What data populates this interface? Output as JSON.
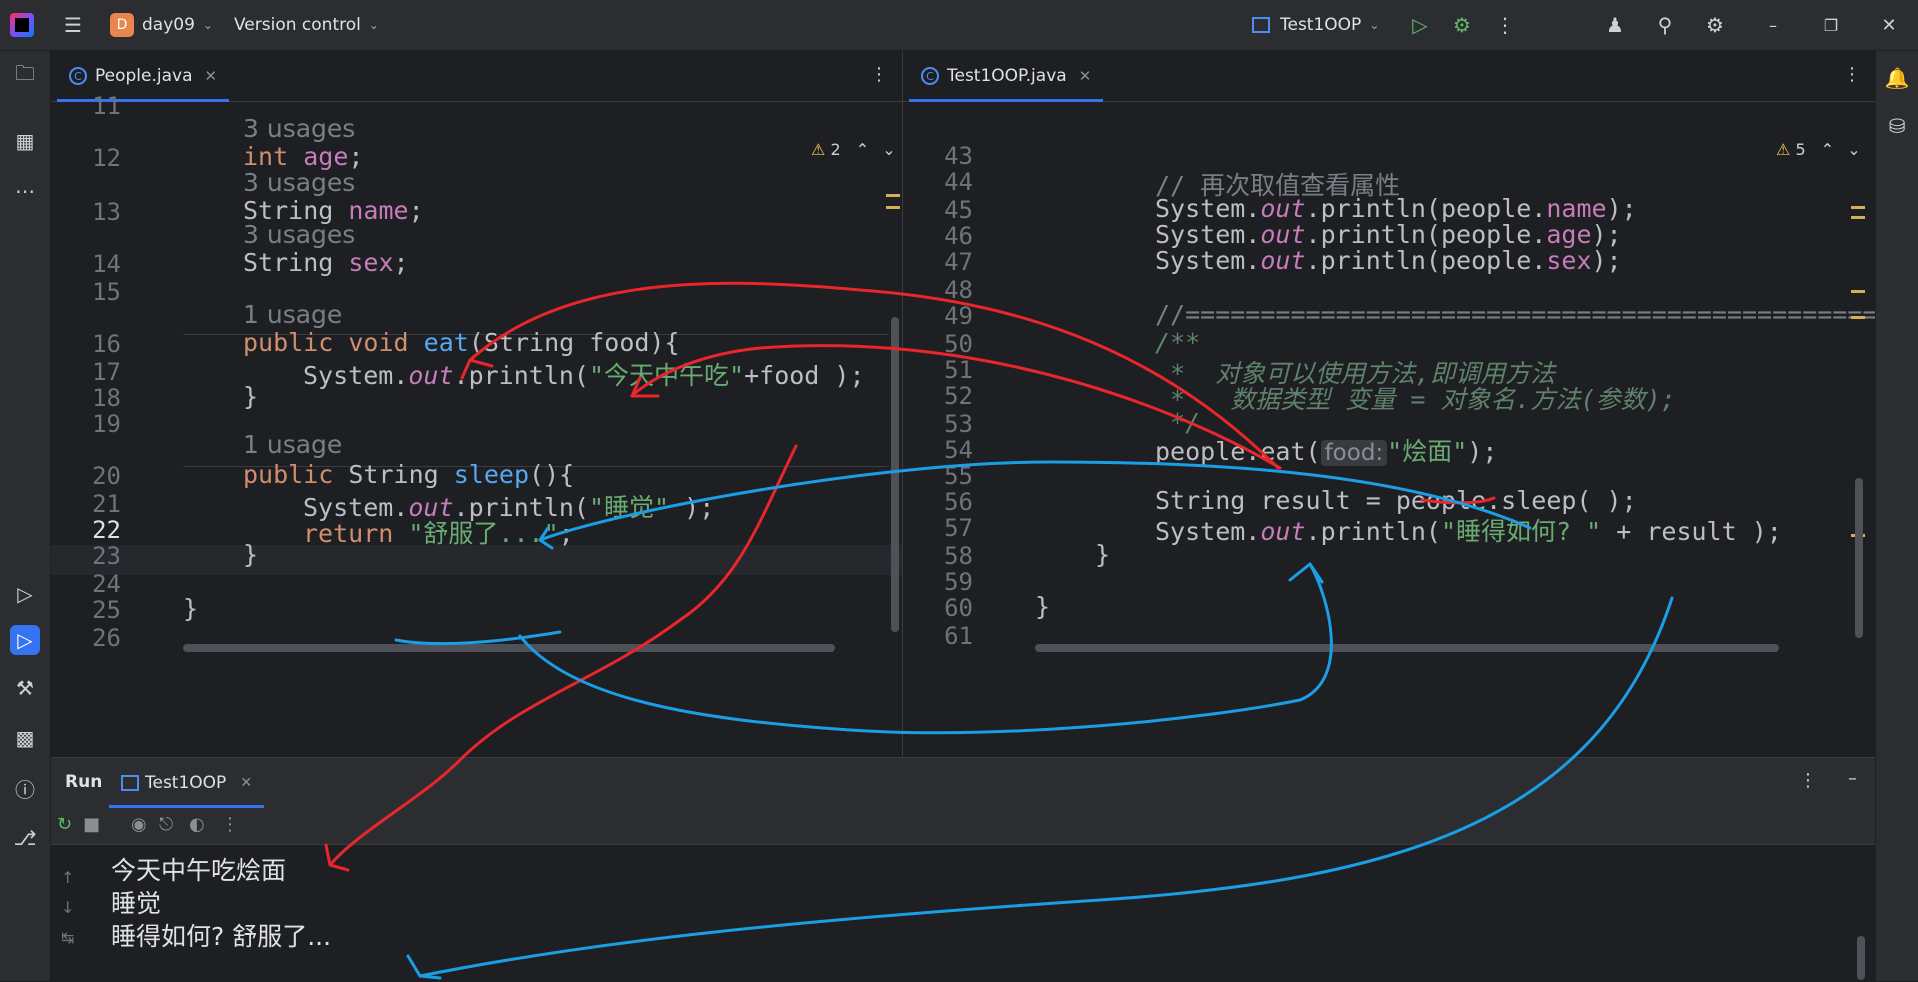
{
  "titlebar": {
    "project_badge": "D",
    "project_name": "day09",
    "vcs": "Version control",
    "run_config": "Test1OOP"
  },
  "left_editor": {
    "tab": "People.java",
    "warnings": "2",
    "lines": {
      "n11": "11",
      "u12": "3 usages",
      "n12": "12",
      "n13": "13",
      "u13": "3 usages",
      "n14": "14",
      "u14": "3 usages",
      "n15": "15",
      "u16": "1 usage",
      "n16": "16",
      "n17": "17",
      "n18": "18",
      "n19": "19",
      "u20": "1 usage",
      "n20": "20",
      "n21": "21",
      "n22": "22",
      "n23": "23",
      "n24": "24",
      "n25": "25",
      "n26": "26"
    },
    "code": {
      "int": "int",
      "age": "age",
      "semi": ";",
      "String": "String",
      "name": "name",
      "sex": "sex",
      "public": "public",
      "void": "void",
      "eat": "eat",
      "eat_params": "(String food){",
      "sys": "System.",
      "out": "out",
      "println": ".println(",
      "str_lunch": "\"今天中午吃\"",
      "plus_food": "+food );",
      "brace_close": "}",
      "sleep": "sleep",
      "sleep_params": "(){",
      "str_sleep": "\"睡觉\"",
      "paren_close": " );",
      "return": "return",
      "str_comfy": "\"舒服了...\""
    }
  },
  "right_editor": {
    "tab": "Test1OOP.java",
    "warnings": "5",
    "lines": {
      "n43": "43",
      "n44": "44",
      "n45": "45",
      "n46": "46",
      "n47": "47",
      "n48": "48",
      "n49": "49",
      "n50": "50",
      "n51": "51",
      "n52": "52",
      "n53": "53",
      "n54": "54",
      "n55": "55",
      "n56": "56",
      "n57": "57",
      "n58": "58",
      "n59": "59",
      "n60": "60",
      "n61": "61"
    },
    "code": {
      "c44": "// 再次取值查看属性",
      "sys": "System.",
      "out": "out",
      "println": ".println(",
      "pp": "people.",
      "name": "name",
      "age": "age",
      "sex": "sex",
      "close": ");",
      "c49": "//================================================",
      "c50": "/**",
      "c51": " *  对象可以使用方法,即调用方法",
      "c52": " *   数据类型 变量 = 对象名.方法(参数);",
      "c53": " */",
      "eat_call": "people.eat(",
      "hint_food": "food:",
      "str_noodle": "\"烩面\"",
      "result_line": "String result = people.sleep( );",
      "str_how": "\"睡得如何? \"",
      "plus_result": " + result );",
      "brace": "}"
    }
  },
  "run_panel": {
    "title": "Run",
    "tab": "Test1OOP",
    "output": [
      "今天中午吃烩面",
      "睡觉",
      "睡得如何? 舒服了..."
    ]
  },
  "colors": {
    "accent": "#3574f0",
    "annotation_red": "#e8262b",
    "annotation_blue": "#1a9ee6"
  }
}
